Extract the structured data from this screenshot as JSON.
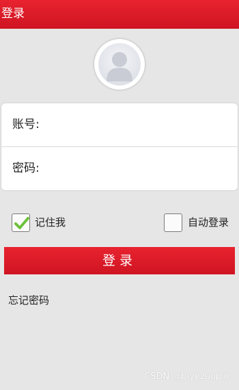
{
  "header": {
    "title": "登录"
  },
  "avatar": {
    "icon": "user-icon"
  },
  "form": {
    "account_label": "账号:",
    "password_label": "密码:"
  },
  "options": {
    "remember_label": "记住我",
    "remember_checked": true,
    "auto_login_label": "自动登录",
    "auto_login_checked": false
  },
  "login_button": {
    "label": "登录"
  },
  "forgot_password": "忘记密码",
  "watermark": "CSDN @biyezuopin",
  "colors": {
    "accent": "#d81b27",
    "background": "#e6e6e6",
    "check": "#6cc23a"
  }
}
